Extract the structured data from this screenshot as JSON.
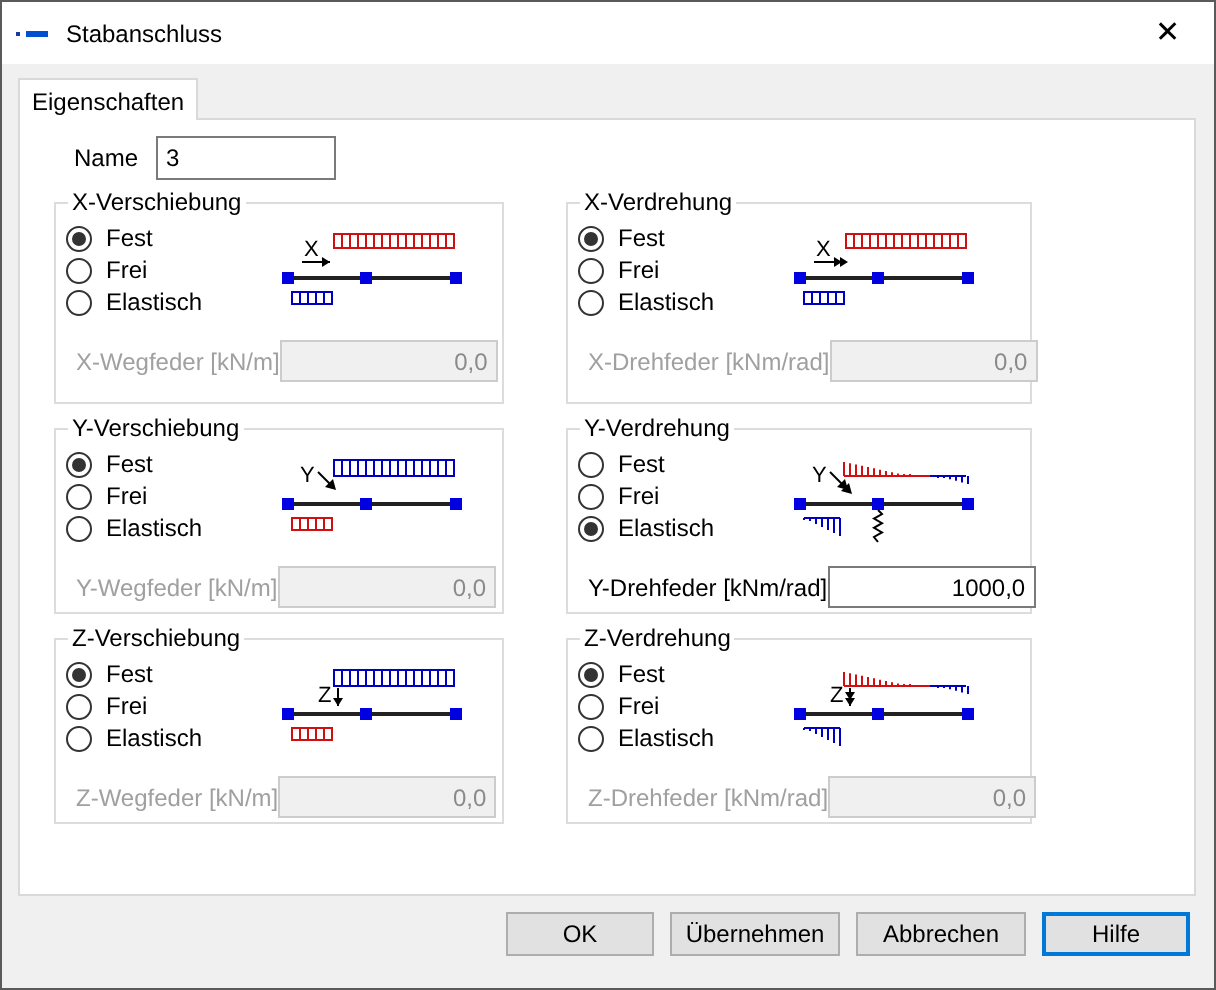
{
  "window": {
    "title": "Stabanschluss",
    "close": "✕"
  },
  "tabs": [
    {
      "label": "Eigenschaften",
      "selected": true
    }
  ],
  "name_field": {
    "label": "Name",
    "value": "3"
  },
  "groups": [
    {
      "title": "X-Verschiebung",
      "options": [
        {
          "label": "Fest",
          "selected": true
        },
        {
          "label": "Frei",
          "selected": false
        },
        {
          "label": "Elastisch",
          "selected": false
        }
      ],
      "diagram": {
        "kind": "translation-x",
        "axis": "X"
      },
      "field": {
        "label": "X-Wegfeder [kN/m]",
        "value": "0,0",
        "disabled": true
      }
    },
    {
      "title": "X-Verdrehung",
      "options": [
        {
          "label": "Fest",
          "selected": true
        },
        {
          "label": "Frei",
          "selected": false
        },
        {
          "label": "Elastisch",
          "selected": false
        }
      ],
      "diagram": {
        "kind": "rotation-x",
        "axis": "X"
      },
      "field": {
        "label": "X-Drehfeder [kNm/rad]",
        "value": "0,0",
        "disabled": true
      }
    },
    {
      "title": "Y-Verschiebung",
      "options": [
        {
          "label": "Fest",
          "selected": true
        },
        {
          "label": "Frei",
          "selected": false
        },
        {
          "label": "Elastisch",
          "selected": false
        }
      ],
      "diagram": {
        "kind": "translation-y",
        "axis": "Y"
      },
      "field": {
        "label": "Y-Wegfeder [kN/m]",
        "value": "0,0",
        "disabled": true
      }
    },
    {
      "title": "Y-Verdrehung",
      "options": [
        {
          "label": "Fest",
          "selected": false
        },
        {
          "label": "Frei",
          "selected": false
        },
        {
          "label": "Elastisch",
          "selected": true
        }
      ],
      "diagram": {
        "kind": "rotation-y",
        "axis": "Y"
      },
      "field": {
        "label": "Y-Drehfeder [kNm/rad]",
        "value": "1000,0",
        "disabled": false
      }
    },
    {
      "title": "Z-Verschiebung",
      "options": [
        {
          "label": "Fest",
          "selected": true
        },
        {
          "label": "Frei",
          "selected": false
        },
        {
          "label": "Elastisch",
          "selected": false
        }
      ],
      "diagram": {
        "kind": "translation-z",
        "axis": "Z"
      },
      "field": {
        "label": "Z-Wegfeder [kN/m]",
        "value": "0,0",
        "disabled": true
      }
    },
    {
      "title": "Z-Verdrehung",
      "options": [
        {
          "label": "Fest",
          "selected": true
        },
        {
          "label": "Frei",
          "selected": false
        },
        {
          "label": "Elastisch",
          "selected": false
        }
      ],
      "diagram": {
        "kind": "rotation-z",
        "axis": "Z"
      },
      "field": {
        "label": "Z-Drehfeder [kNm/rad]",
        "value": "0,0",
        "disabled": true
      }
    }
  ],
  "buttons": [
    {
      "label": "OK",
      "focused": false
    },
    {
      "label": "Übernehmen",
      "focused": false
    },
    {
      "label": "Abbrechen",
      "focused": false
    },
    {
      "label": "Hilfe",
      "focused": true
    }
  ]
}
